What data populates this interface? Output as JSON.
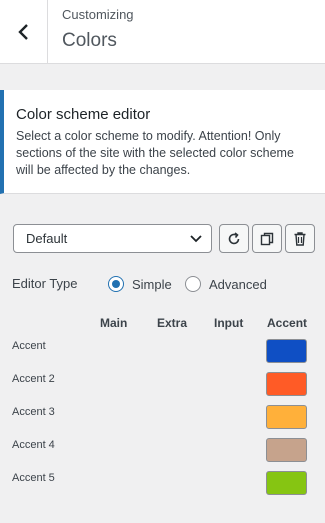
{
  "header": {
    "breadcrumb": "Customizing",
    "title": "Colors"
  },
  "description": {
    "heading": "Color scheme editor",
    "text": "Select a color scheme to modify. Attention! Only sections of the site with the selected color scheme will be affected by the changes."
  },
  "scheme_select": {
    "value": "Default"
  },
  "editor_type": {
    "label": "Editor Type",
    "options": [
      {
        "label": "Simple",
        "selected": true
      },
      {
        "label": "Advanced",
        "selected": false
      }
    ]
  },
  "table": {
    "columns": [
      "Main",
      "Extra",
      "Input",
      "Accent"
    ],
    "rows": [
      {
        "label": "Accent",
        "color": "#0f4fc4"
      },
      {
        "label": "Accent 2",
        "color": "#ff5b26"
      },
      {
        "label": "Accent 3",
        "color": "#ffb03a"
      },
      {
        "label": "Accent 4",
        "color": "#c6a38c"
      },
      {
        "label": "Accent 5",
        "color": "#86c512"
      }
    ]
  },
  "icons": {
    "back": "chevron-left-icon",
    "reset": "reset-icon",
    "copy": "copy-icon",
    "delete": "trash-icon",
    "dropdown": "chevron-down-icon"
  },
  "colors": {
    "accent_blue": "#2271b1"
  }
}
